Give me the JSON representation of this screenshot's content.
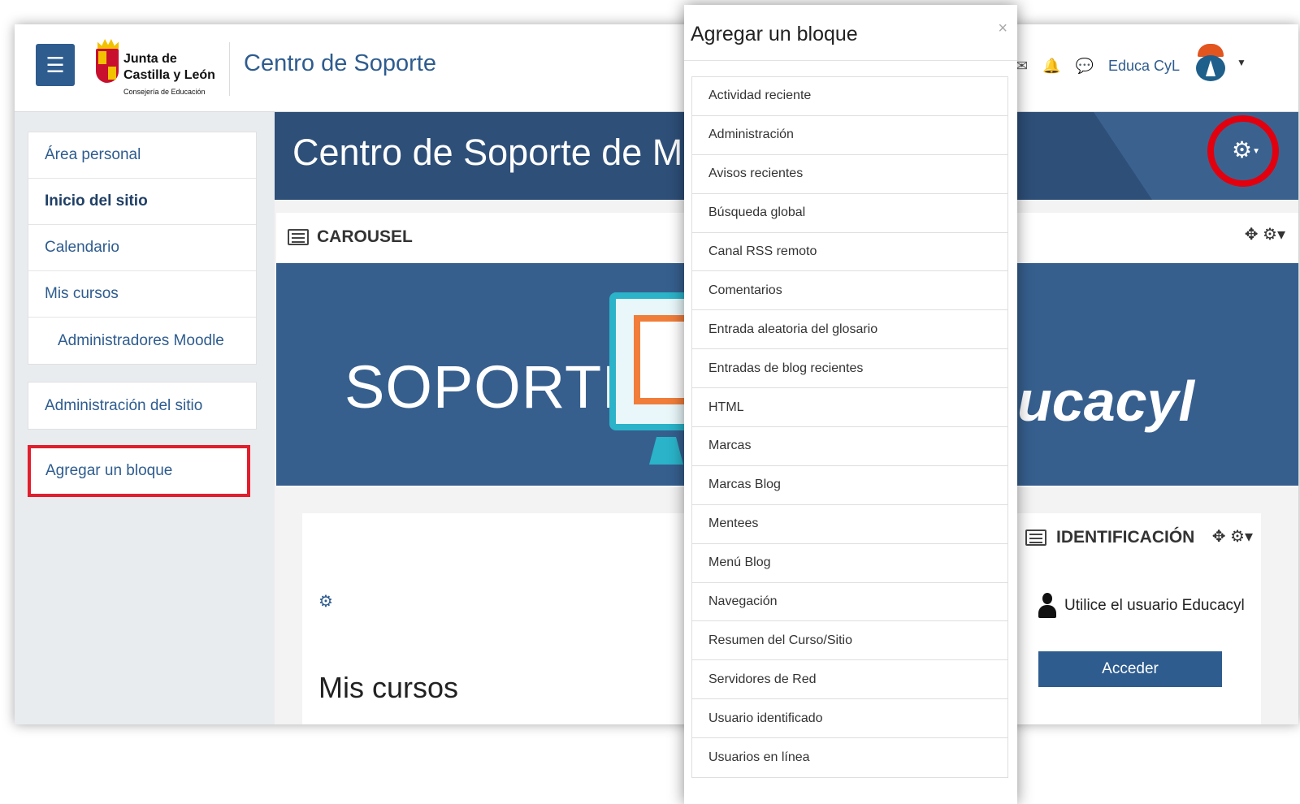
{
  "header": {
    "menu_icon": "hamburger-icon",
    "logo": {
      "line1": "Junta de",
      "line2": "Castilla y León",
      "line3": "Consejería de Educación"
    },
    "site_name": "Centro de Soporte",
    "icons": [
      "envelope-icon",
      "bell-icon",
      "chat-icon"
    ],
    "user_name": "Educa CyL"
  },
  "sidebar": {
    "items": [
      {
        "label": "Área personal"
      },
      {
        "label": "Inicio del sitio"
      },
      {
        "label": "Calendario"
      },
      {
        "label": "Mis cursos"
      },
      {
        "label": "Administradores Moodle"
      }
    ],
    "admin_label": "Administración del sitio",
    "add_block_label": "Agregar un bloque"
  },
  "main": {
    "banner_title": "Centro de Soporte de Moodle",
    "carousel": {
      "title": "CAROUSEL",
      "soporte_text": "SOPORTE",
      "brand_text": "ucacyl"
    },
    "mycourses": {
      "title": "Mis cursos"
    },
    "identificacion": {
      "title": "IDENTIFICACIÓN",
      "user_text": "Utilice el usuario Educacyl",
      "button_label": "Acceder"
    }
  },
  "modal": {
    "title": "Agregar un bloque",
    "close": "×",
    "items": [
      "Actividad reciente",
      "Administración",
      "Avisos recientes",
      "Búsqueda global",
      "Canal RSS remoto",
      "Comentarios",
      "Entrada aleatoria del glosario",
      "Entradas de blog recientes",
      "HTML",
      "Marcas",
      "Marcas Blog",
      "Mentees",
      "Menú Blog",
      "Navegación",
      "Resumen del Curso/Sitio",
      "Servidores de Red",
      "Usuario identificado",
      "Usuarios en línea"
    ]
  },
  "colors": {
    "primary": "#2e5c8f",
    "banner": "#2e4f78",
    "highlight": "#e21e2d"
  }
}
